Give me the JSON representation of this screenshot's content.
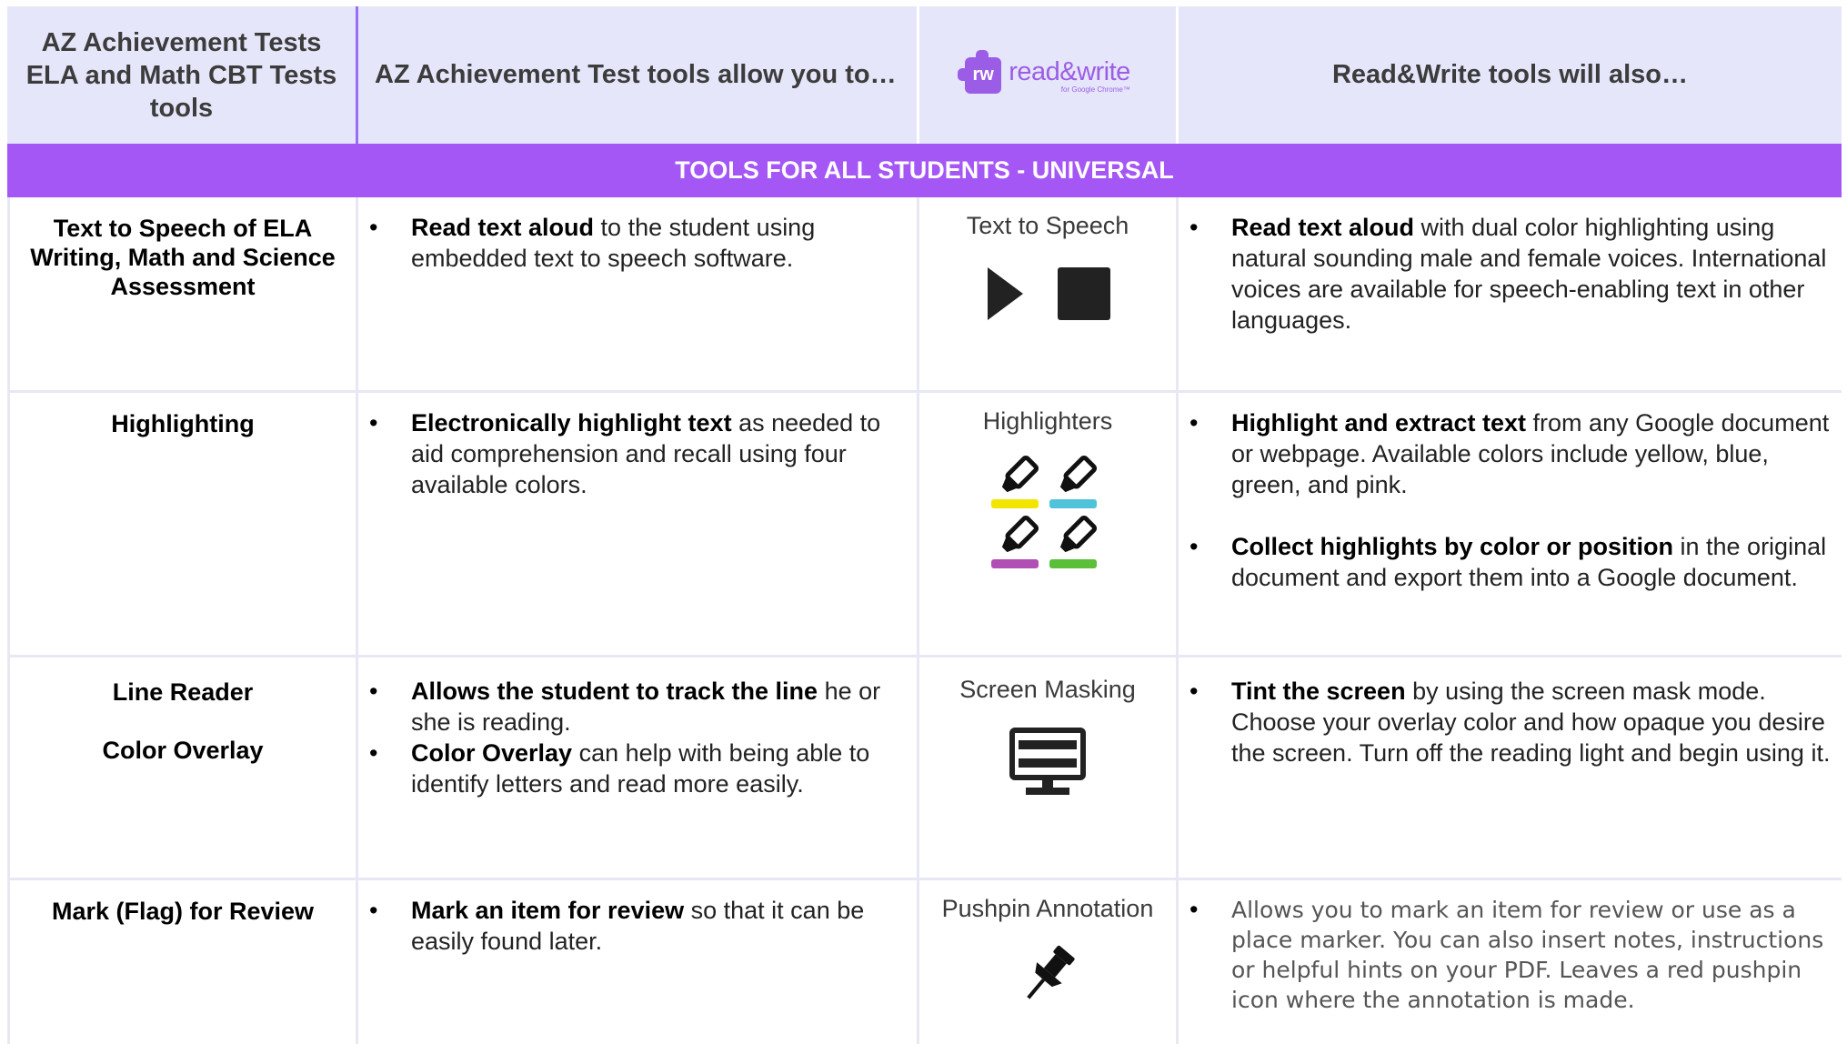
{
  "header": {
    "col1": "AZ Achievement Tests ELA and Math CBT Tests tools",
    "col2": "AZ Achievement Test tools allow you to…",
    "logo_mark": "rw",
    "logo_word": "read&write",
    "logo_sub": "for Google Chrome™",
    "col4": "Read&Write tools will also…"
  },
  "banner": "TOOLS FOR ALL STUDENTS - UNIVERSAL",
  "rows": [
    {
      "tool": "Text to Speech of ELA Writing, Math and Science Assessment",
      "az": [
        {
          "bold": "Read text aloud",
          "rest": " to the student using embedded text to speech software."
        }
      ],
      "rw_tool": "Text to Speech",
      "rw_icons": [
        "play-icon",
        "stop-icon"
      ],
      "rw": [
        {
          "bold": "Read text aloud",
          "rest": " with dual color highlighting using natural sounding male and female voices. International voices are available for speech-enabling text in other languages."
        }
      ]
    },
    {
      "tool": "Highlighting",
      "az": [
        {
          "bold": "Electronically highlight text",
          "rest": " as needed to aid comprehension and recall using four available colors."
        }
      ],
      "rw_tool": "Highlighters",
      "rw_icons": [
        "highlighter-yellow-icon",
        "highlighter-blue-icon",
        "highlighter-pink-icon",
        "highlighter-green-icon"
      ],
      "highlighter_colors": [
        "#f2e600",
        "#4fc3d9",
        "#b14fb4",
        "#5bbf3a"
      ],
      "rw": [
        {
          "bold": "Highlight and extract text",
          "rest": " from any Google document or webpage. Available colors include yellow, blue, green, and pink."
        },
        {
          "bold": "Collect highlights by color or position",
          "rest": " in the original document  and export them into a Google document."
        }
      ]
    },
    {
      "tool_line1": "Line Reader",
      "tool_line2": "Color Overlay",
      "az": [
        {
          "bold": "Allows the student to track the line",
          "rest": " he or she is reading."
        },
        {
          "bold": "Color Overlay",
          "rest": " can help with being able to identify letters and read more easily."
        }
      ],
      "rw_tool": "Screen Masking",
      "rw_icons": [
        "screen-mask-icon"
      ],
      "rw": [
        {
          "bold": "Tint the screen",
          "rest": " by using the screen mask mode. Choose your overlay color and how opaque you desire the screen.  Turn off the reading light and begin using it."
        }
      ]
    },
    {
      "tool": "Mark (Flag) for Review",
      "az": [
        {
          "bold": "Mark an item for review",
          "rest": " so that it can be easily found later."
        }
      ],
      "rw_tool": "Pushpin Annotation",
      "rw_icons": [
        "pushpin-icon"
      ],
      "rw": [
        {
          "bold": "",
          "rest": "Allows you to mark an item for review or use as a place marker.  You can also insert notes, instructions or helpful hints on your PDF. Leaves a red pushpin icon where the annotation is made."
        }
      ]
    }
  ],
  "colors": {
    "header_bg": "#e6e6fb",
    "banner_bg": "#a557f6",
    "brand_purple": "#9b5de5",
    "grid": "#e8e8f4"
  }
}
